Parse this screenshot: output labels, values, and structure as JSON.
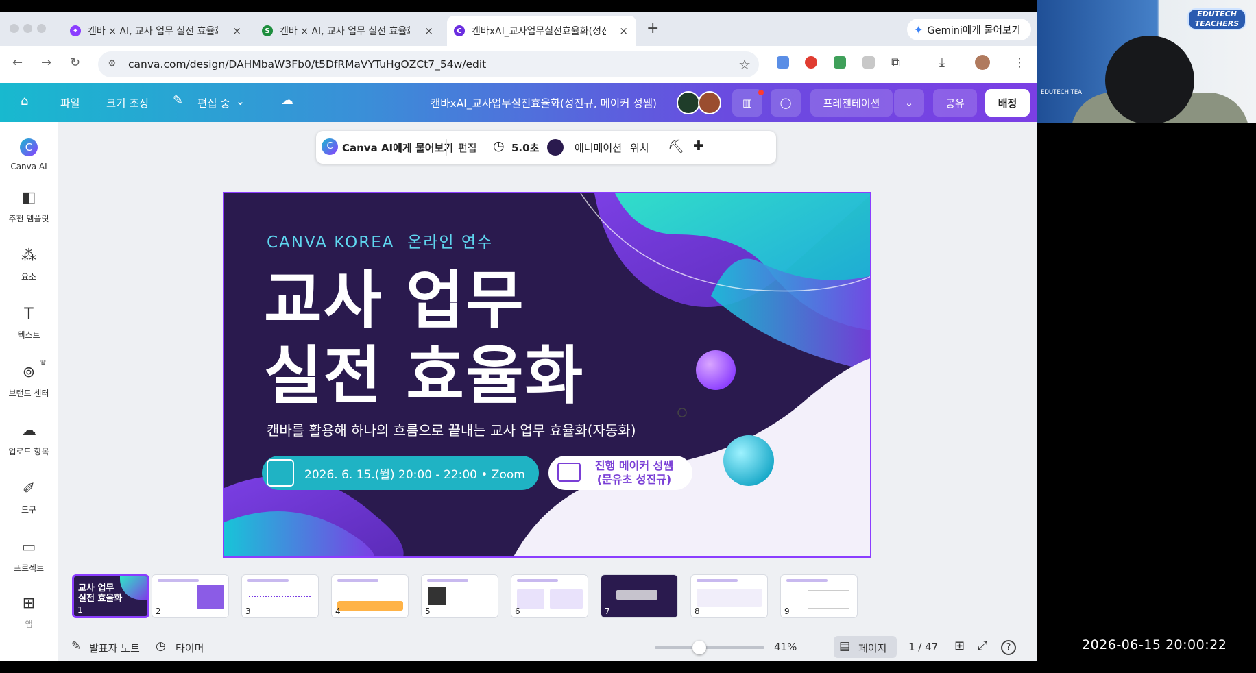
{
  "browser": {
    "tabs": [
      {
        "title": "캔바 × AI, 교사 업무 실전 효율화(",
        "favicon_color": "#8b3dff"
      },
      {
        "title": "캔바 × AI, 교사 업무 실전 효율화(",
        "favicon_color": "#1e8e3e",
        "favicon_letter": "S"
      },
      {
        "title": "캔바xAI_교사업무실전효율화(성진",
        "favicon_color": "#6b2ee0",
        "active": true
      }
    ],
    "new_tab": "+",
    "tab_close": "×",
    "gemini_label": "Gemini에게 물어보기",
    "url": "canva.com/design/DAHMbaW3Fb0/t5DfRMaVYTuHgOZCt7_54w/edit"
  },
  "header": {
    "file": "파일",
    "resize": "크기 조정",
    "editing": "편집 중",
    "doc_title": "캔바xAI_교사업무실전효율화(성진규, 메이커 성쌤)",
    "present": "프레젠테이션",
    "share": "공유",
    "publish": "배정"
  },
  "sidebar": {
    "items": [
      {
        "label": "Canva AI",
        "icon": "canva-ai-icon"
      },
      {
        "label": "추천 템플릿",
        "icon": "template-icon"
      },
      {
        "label": "요소",
        "icon": "elements-icon"
      },
      {
        "label": "텍스트",
        "icon": "text-icon"
      },
      {
        "label": "브랜드 센터",
        "icon": "brand-icon"
      },
      {
        "label": "업로드 항목",
        "icon": "upload-icon"
      },
      {
        "label": "도구",
        "icon": "tools-icon"
      },
      {
        "label": "프로젝트",
        "icon": "folder-icon"
      },
      {
        "label": "앱",
        "icon": "apps-icon"
      }
    ]
  },
  "toolbar": {
    "ask_ai": "Canva AI에게 물어보기",
    "edit": "편집",
    "duration": "5.0초",
    "animation": "애니메이션",
    "position": "위치"
  },
  "slide": {
    "kicker_a": "CANVA KOREA",
    "kicker_b": "온라인 연수",
    "title_line1": "교사 업무",
    "title_line2": "실전 효율화",
    "subtitle": "캔바를 활용해 하나의 흐름으로 끝내는 교사 업무 효율화(자동화)",
    "date_pill": "2026. 6. 15.(월) 20:00 - 22:00 • Zoom",
    "host_line1": "진행 메이커 성쌤",
    "host_line2": "(문유초 성진규)",
    "bg_color": "#2a1a4e",
    "accent_color": "#8b3dff"
  },
  "thumbnails": [
    {
      "num": "1",
      "dark": true,
      "label": "교사 업무\n실전 효율화"
    },
    {
      "num": "2",
      "dark": false
    },
    {
      "num": "3",
      "dark": false
    },
    {
      "num": "4",
      "dark": false
    },
    {
      "num": "5",
      "dark": false
    },
    {
      "num": "6",
      "dark": false
    },
    {
      "num": "7",
      "dark": true
    },
    {
      "num": "8",
      "dark": false
    },
    {
      "num": "9",
      "dark": false
    }
  ],
  "bottombar": {
    "notes": "발표자 노트",
    "timer": "타이머",
    "zoom": "41%",
    "zoom_fraction": 0.41,
    "page_view": "페이지",
    "page_count": "1 / 47"
  },
  "overlay": {
    "timestamp": "2026-06-15 20:00:22",
    "cam_logo": "EDUTECH TEACHERS",
    "cam_brand": "EDUTECH TEA"
  }
}
